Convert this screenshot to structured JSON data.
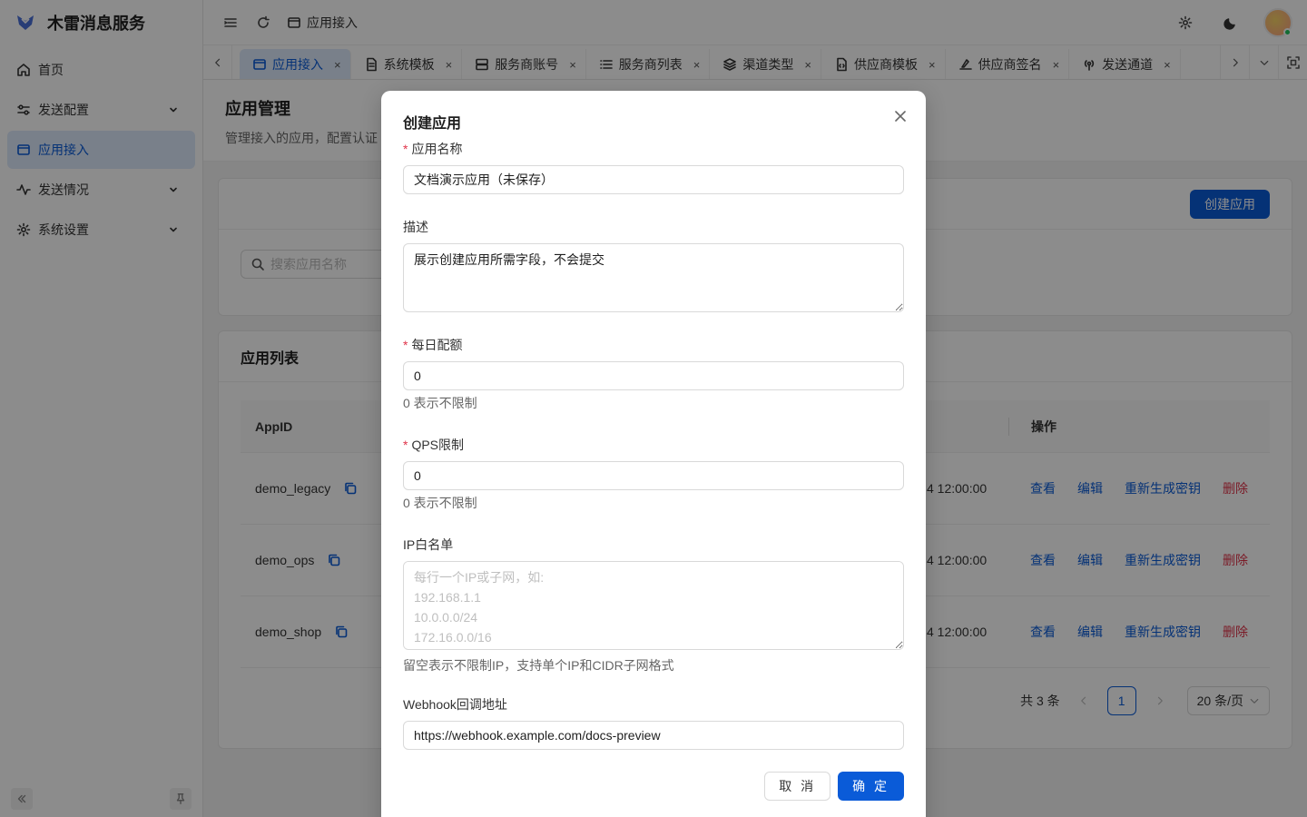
{
  "brand": {
    "title": "木雷消息服务"
  },
  "sidebar": {
    "items": [
      {
        "label": "首页",
        "icon": "home-icon"
      },
      {
        "label": "发送配置",
        "icon": "sliders-icon"
      },
      {
        "label": "应用接入",
        "icon": "window-icon"
      },
      {
        "label": "发送情况",
        "icon": "activity-icon"
      },
      {
        "label": "系统设置",
        "icon": "gear-icon"
      }
    ]
  },
  "header": {
    "crumb": "应用接入"
  },
  "tabs": [
    {
      "label": "应用接入"
    },
    {
      "label": "系统模板"
    },
    {
      "label": "服务商账号"
    },
    {
      "label": "服务商列表"
    },
    {
      "label": "渠道类型"
    },
    {
      "label": "供应商模板"
    },
    {
      "label": "供应商签名"
    },
    {
      "label": "发送通道"
    }
  ],
  "tab_close": "×",
  "page": {
    "title": "应用管理",
    "desc": "管理接入的应用，配置认证"
  },
  "toolbar": {
    "create_label": "创建应用",
    "search_placeholder": "搜索应用名称"
  },
  "list": {
    "title": "应用列表",
    "col_appid": "AppID",
    "col_ops": "操作",
    "rows": [
      {
        "appid": "demo_legacy",
        "time": "4 12:00:00"
      },
      {
        "appid": "demo_ops",
        "time": "4 12:00:00"
      },
      {
        "appid": "demo_shop",
        "time": "4 12:00:00"
      }
    ],
    "ops": {
      "view": "查看",
      "edit": "编辑",
      "regen": "重新生成密钥",
      "delete": "删除"
    }
  },
  "pager": {
    "total": "共 3 条",
    "current": "1",
    "size": "20 条/页"
  },
  "modal": {
    "title": "创建应用",
    "name_label": "应用名称",
    "name_value": "文档演示应用（未保存）",
    "desc_label": "描述",
    "desc_value": "展示创建应用所需字段，不会提交",
    "quota_label": "每日配额",
    "quota_value": "0",
    "quota_help": "0 表示不限制",
    "qps_label": "QPS限制",
    "qps_value": "0",
    "qps_help": "0 表示不限制",
    "ip_label": "IP白名单",
    "ip_placeholder": "每行一个IP或子网，如:\n192.168.1.1\n10.0.0.0/24\n172.16.0.0/16",
    "ip_help": "留空表示不限制IP，支持单个IP和CIDR子网格式",
    "webhook_label": "Webhook回调地址",
    "webhook_value": "https://webhook.example.com/docs-preview",
    "cancel_label": "取 消",
    "ok_label": "确 定"
  },
  "colors": {
    "primary": "#0a5bd8",
    "danger": "#e0344a",
    "active_bg": "#dde9fb"
  }
}
